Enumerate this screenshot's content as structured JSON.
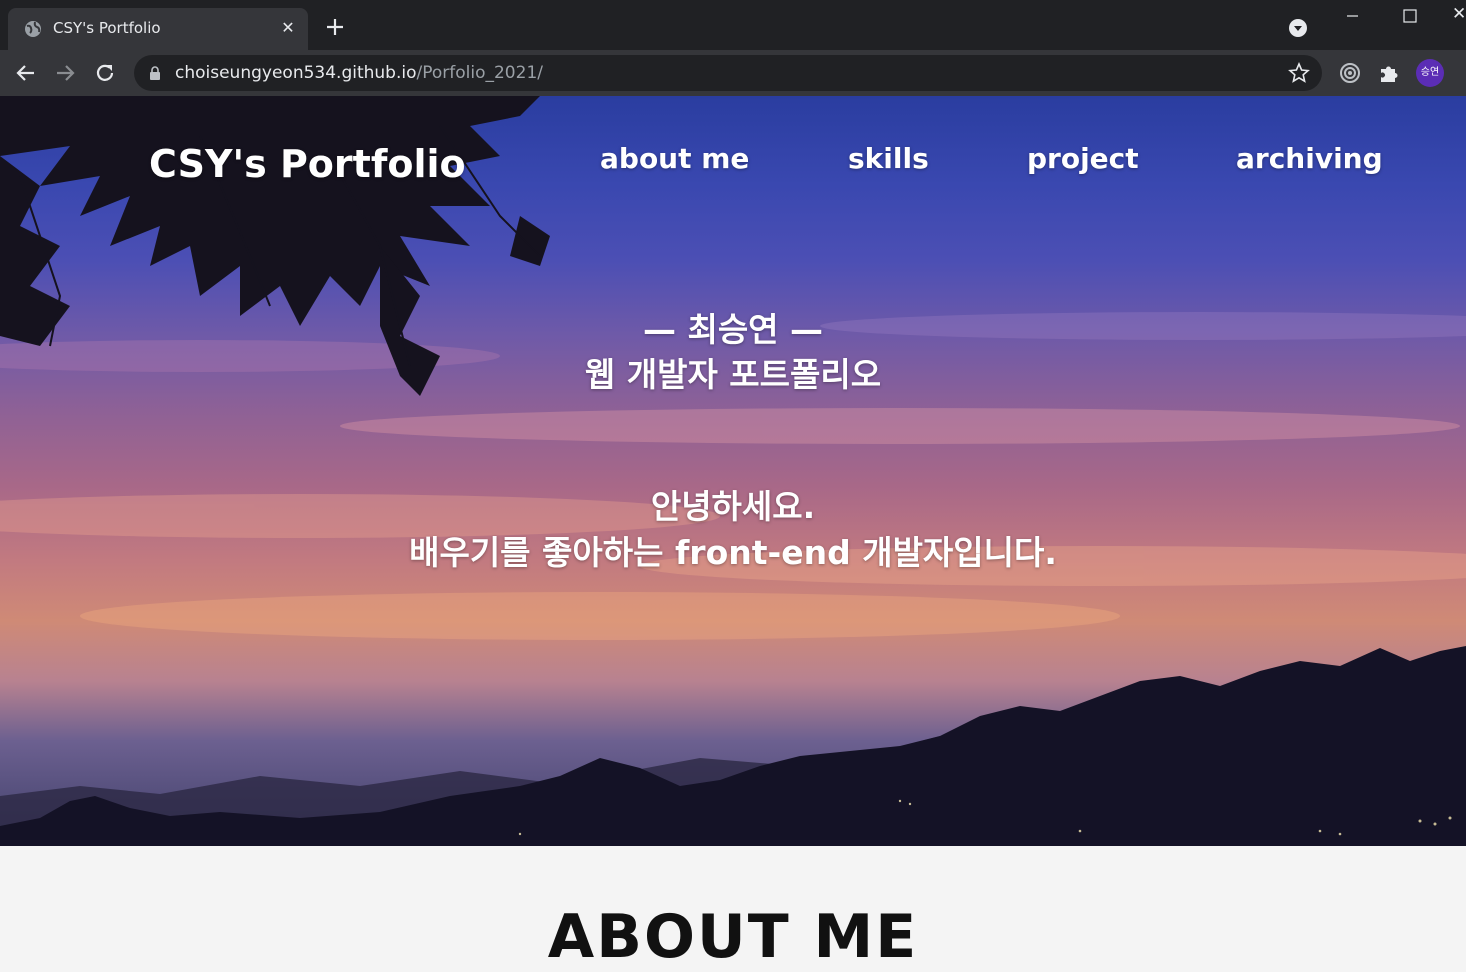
{
  "browser": {
    "tab_title": "CSY's Portfolio",
    "url_host": "choiseungyeon534.github.io",
    "url_path": "/Porfolio_2021/",
    "profile_initials": "승연",
    "profile_color": "#5b2db5"
  },
  "header": {
    "logo": "CSY's Portfolio",
    "nav": [
      {
        "label": "about me"
      },
      {
        "label": "skills"
      },
      {
        "label": "project"
      },
      {
        "label": "archiving"
      }
    ]
  },
  "hero": {
    "name_line": "— 최승연 —",
    "subtitle": "웹 개발자 포트폴리오",
    "greeting": "안녕하세요.",
    "intro": "배우기를 좋아하는 front-end 개발자입니다."
  },
  "about": {
    "title": "ABOUT ME"
  }
}
